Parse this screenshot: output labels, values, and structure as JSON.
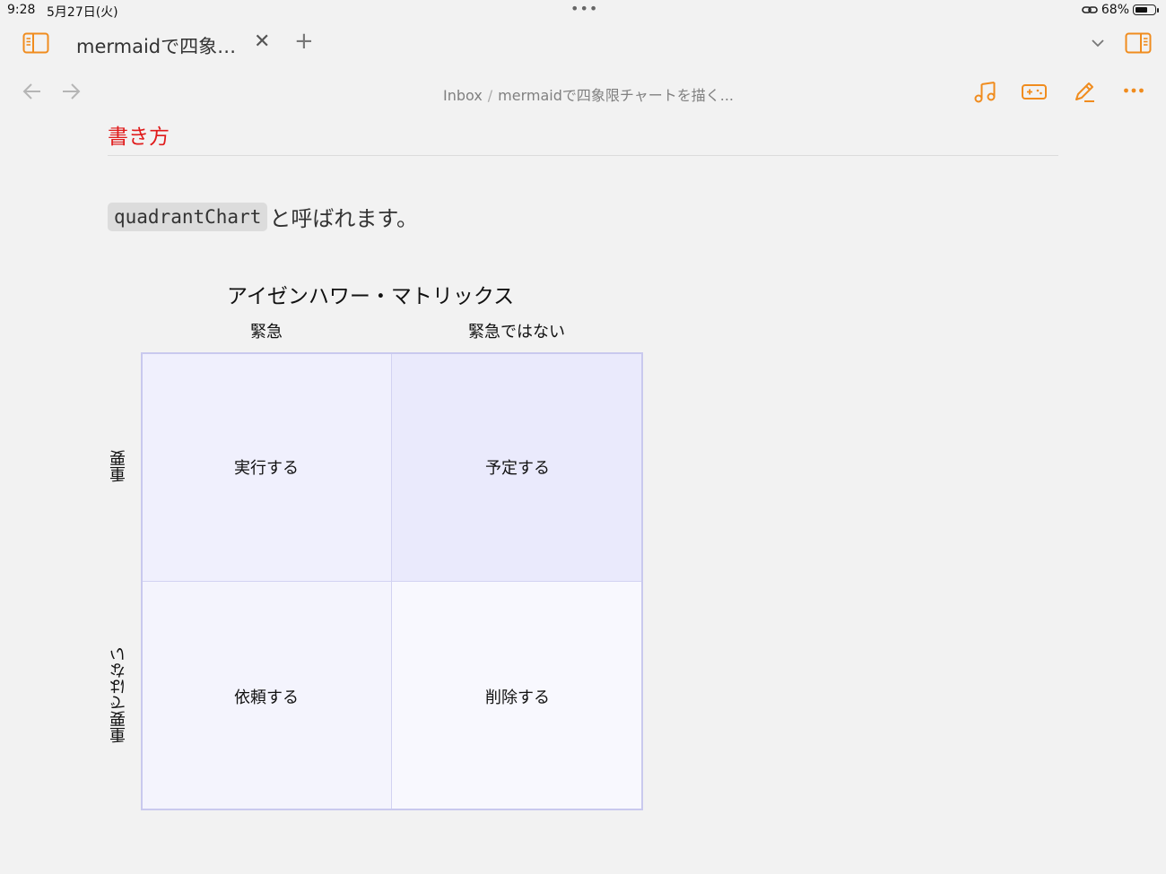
{
  "status_bar": {
    "time": "9:28",
    "date": "5月27日(火)",
    "dots": "•••",
    "battery_percent": "68%",
    "battery_level": 0.68
  },
  "tab_bar": {
    "sidebar_icon": "sidebar-left-icon",
    "tab_title": "mermaidで四象…",
    "close_label": "✕",
    "add_label": "+",
    "dropdown_icon": "chevron-down-icon",
    "right_panel_icon": "sidebar-right-icon"
  },
  "nav": {
    "back_icon": "arrow-left-icon",
    "forward_icon": "arrow-right-icon",
    "breadcrumb": [
      "Inbox",
      "mermaidで四象限チャートを描く..."
    ],
    "breadcrumb_sep": "/",
    "actions": [
      "music-note-icon",
      "gamepad-icon",
      "pencil-icon",
      "more-icon"
    ]
  },
  "content": {
    "heading": "書き方",
    "code": "quadrantChart",
    "paragraph_tail": "と呼ばれます。"
  },
  "chart_data": {
    "type": "quadrant",
    "title": "アイゼンハワー・マトリックス",
    "x_axis": [
      "緊急",
      "緊急ではない"
    ],
    "y_axis": [
      "重要ではない",
      "重要"
    ],
    "quadrants": [
      {
        "label": "実行する",
        "position": "top-left",
        "color": "#f0f0fd"
      },
      {
        "label": "予定する",
        "position": "top-right",
        "color": "#eaeafc"
      },
      {
        "label": "依頼する",
        "position": "bottom-left",
        "color": "#f4f4fd"
      },
      {
        "label": "削除する",
        "position": "bottom-right",
        "color": "#f8f8fe"
      }
    ]
  },
  "colors": {
    "accent": "#f08c1e",
    "heading": "#e01b1b",
    "background": "#f2f2f2",
    "quadrant_border": "#c9c9ee"
  }
}
